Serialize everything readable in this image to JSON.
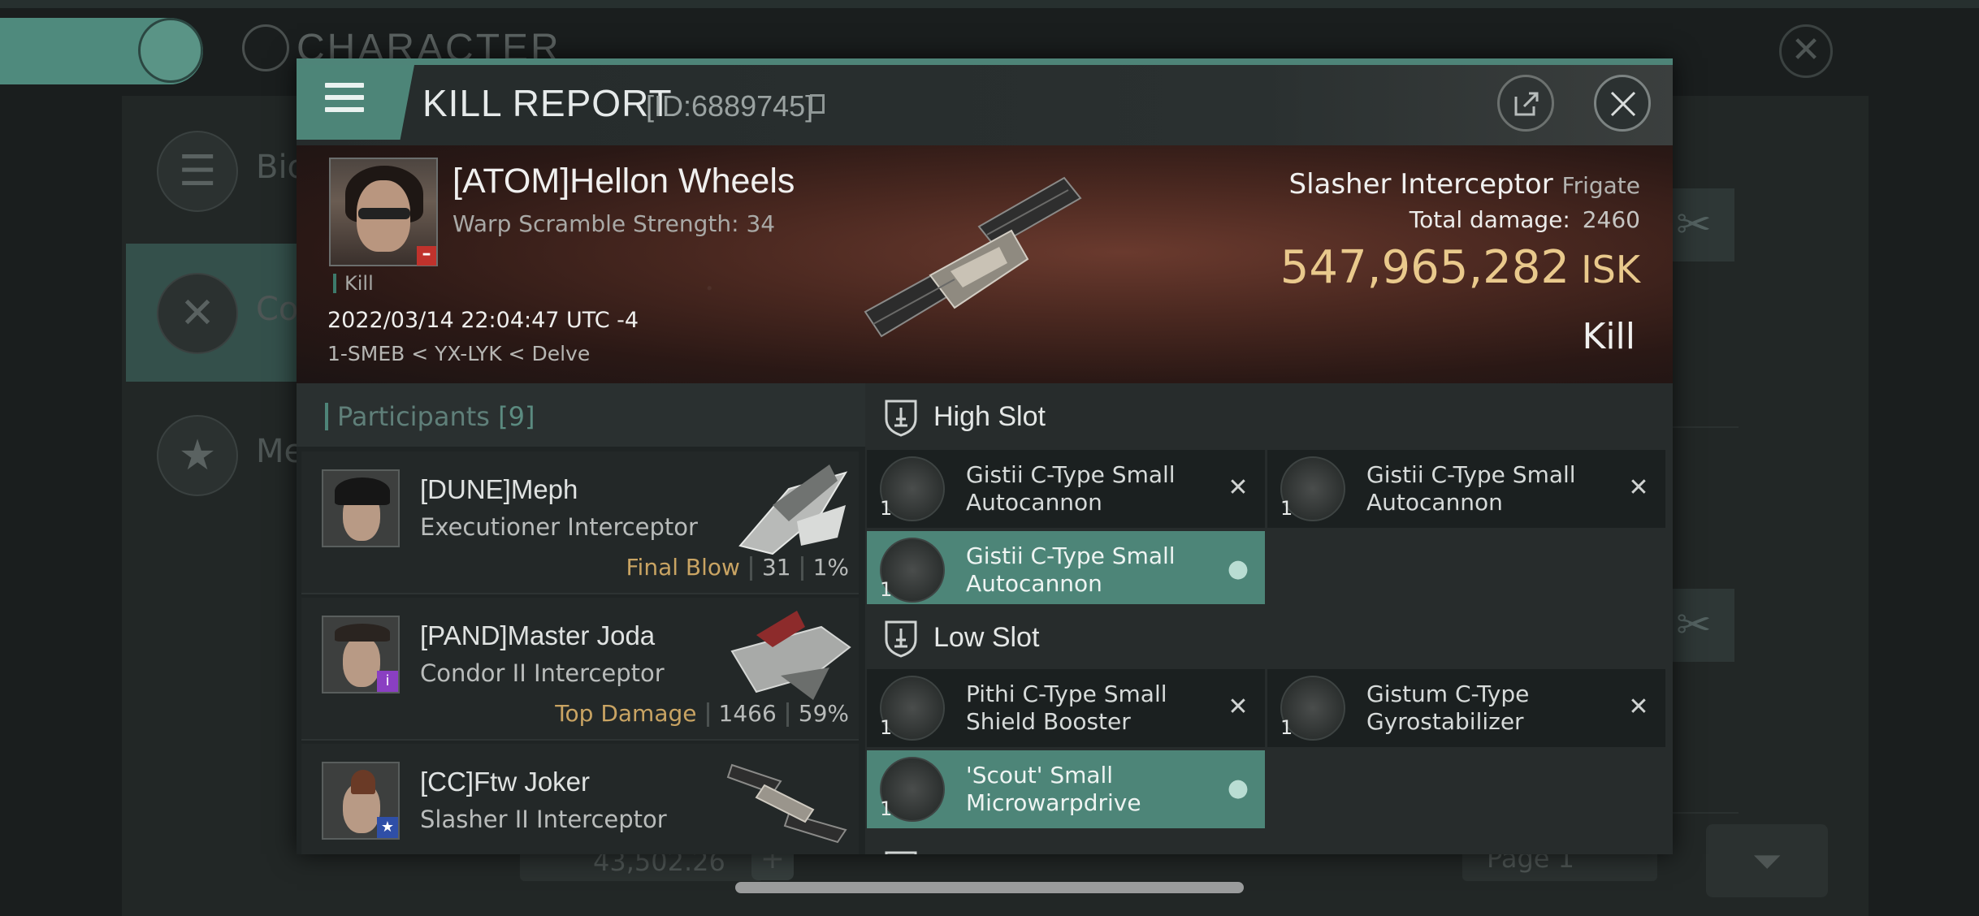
{
  "background": {
    "title": "CHARACTER",
    "sidebar": [
      {
        "label": "Bio"
      },
      {
        "label": "Co"
      },
      {
        "label": "Me"
      }
    ],
    "wallet_value": "43,502.26",
    "page_label": "Page 1"
  },
  "kill_report": {
    "title": "KILL REPORT",
    "id_text": "[ID:6889745]",
    "victim": {
      "name": "[ATOM]Hellon Wheels",
      "subtitle": "Warp Scramble Strength: 34",
      "tag": "Kill",
      "datetime": "2022/03/14 22:04:47 UTC -4",
      "location": "1-SMEB < YX-LYK < Delve"
    },
    "ship": {
      "name": "Slasher Interceptor",
      "class": "Frigate",
      "total_damage_label": "Total damage:",
      "total_damage": "2460",
      "isk_value": "547,965,282",
      "isk_unit": "ISK",
      "result": "Kill"
    },
    "participants": {
      "label": "Participants",
      "count": "[9]",
      "items": [
        {
          "name": "[DUNE]Meph",
          "ship": "Executioner Interceptor",
          "label": "Final Blow",
          "damage": "31",
          "percent": "1%"
        },
        {
          "name": "[PAND]Master Joda",
          "ship": "Condor II Interceptor",
          "label": "Top Damage",
          "damage": "1466",
          "percent": "59%"
        },
        {
          "name": "[CC]Ftw Joker",
          "ship": "Slasher II Interceptor",
          "label": "",
          "damage": "",
          "percent": ""
        }
      ]
    },
    "fittings": {
      "high_slot_label": "High Slot",
      "low_slot_label": "Low Slot",
      "high": [
        {
          "name": "Gistii C-Type Small Autocannon",
          "qty": "1",
          "status": "destroyed"
        },
        {
          "name": "Gistii C-Type Small Autocannon",
          "qty": "1",
          "status": "destroyed"
        },
        {
          "name": "Gistii C-Type Small Autocannon",
          "qty": "1",
          "status": "dropped"
        }
      ],
      "low": [
        {
          "name": "Pithi C-Type Small Shield Booster",
          "qty": "1",
          "status": "destroyed"
        },
        {
          "name": "Gistum C-Type Gyrostabilizer",
          "qty": "1",
          "status": "destroyed"
        },
        {
          "name": "'Scout' Small Microwarpdrive",
          "qty": "1",
          "status": "dropped"
        }
      ]
    }
  },
  "colors": {
    "accent": "#4d8578",
    "isk": "#e9c98c",
    "final_blow": "#c9a463",
    "banner": "#4a2820"
  },
  "icons": [
    "menu-icon",
    "copy-icon",
    "share-icon",
    "close-icon",
    "high-slot-icon",
    "low-slot-icon",
    "destroyed-x-icon",
    "dropped-person-icon"
  ]
}
